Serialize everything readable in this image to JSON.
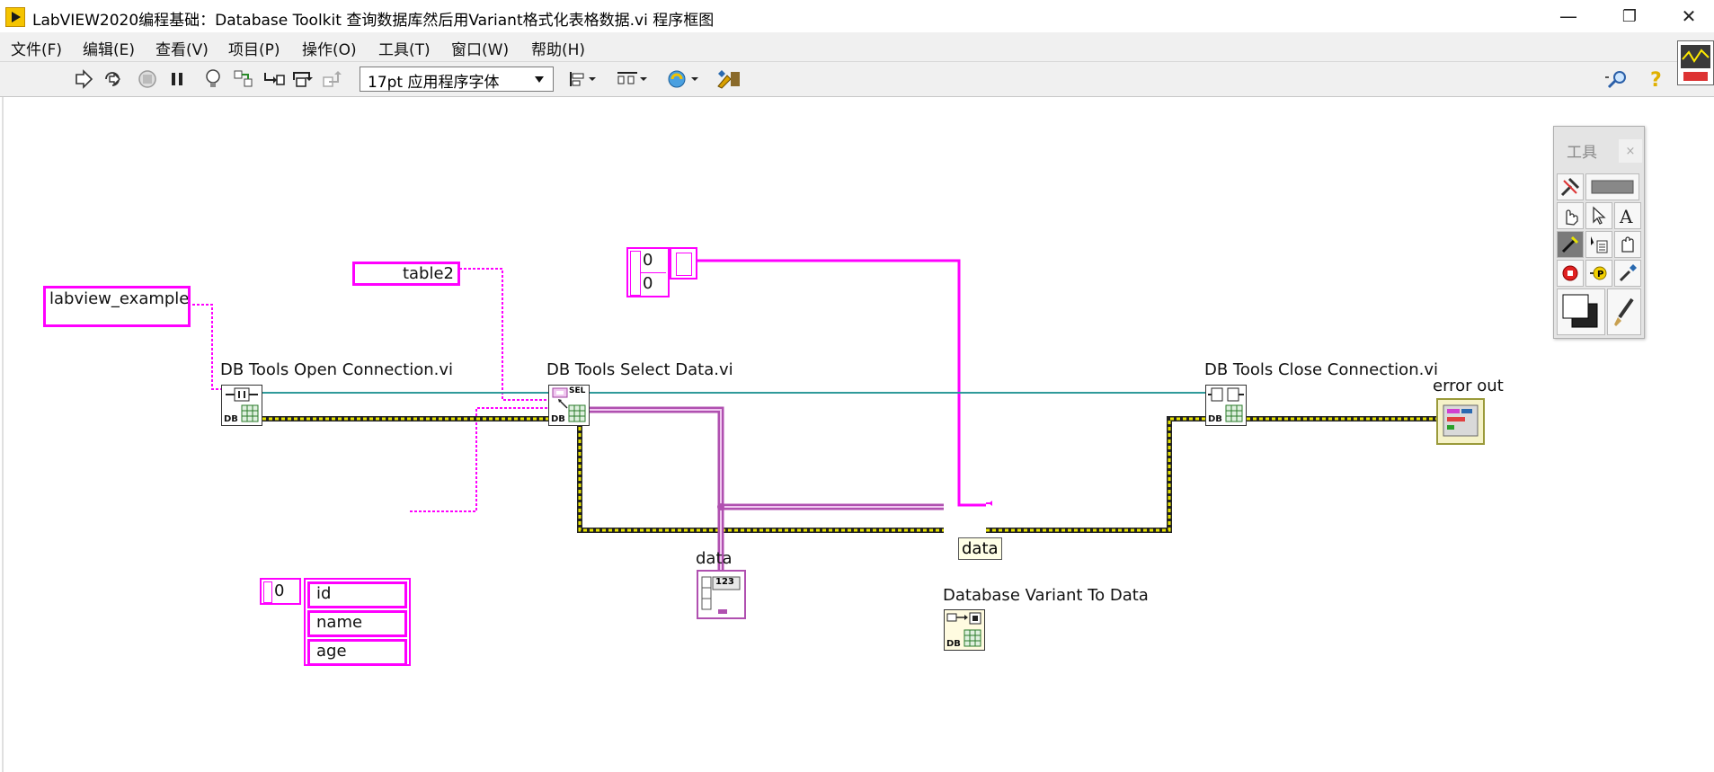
{
  "window": {
    "title": "LabVIEW2020编程基础：Database Toolkit 查询数据库然后用Variant格式化表格数据.vi 程序框图",
    "minimize": "—",
    "restore": "❐",
    "close": "✕"
  },
  "menu": [
    {
      "label": "文件(F)"
    },
    {
      "label": "编辑(E)"
    },
    {
      "label": "查看(V)"
    },
    {
      "label": "项目(P)"
    },
    {
      "label": "操作(O)"
    },
    {
      "label": "工具(T)"
    },
    {
      "label": "窗口(W)"
    },
    {
      "label": "帮助(H)"
    }
  ],
  "toolbar": {
    "font_value": "17pt 应用程序字体",
    "icons": [
      "run-arrow-icon",
      "run-continuously-icon",
      "abort-icon",
      "pause-icon",
      "highlight-execution-icon",
      "retain-wire-values-icon",
      "step-into-icon",
      "step-over-icon",
      "step-out-icon",
      "align-objects-icon",
      "distribute-objects-icon",
      "reorder-icon",
      "cleanup-diagram-icon",
      "search-icon",
      "context-help-icon"
    ]
  },
  "diagram": {
    "constants": {
      "db_name": "labview_example",
      "table_name": "table2",
      "array_index_a": "0",
      "array_index_b": "0",
      "columns_index": "0",
      "columns": [
        "id",
        "name",
        "age"
      ]
    },
    "nodes": {
      "open_connection": "DB Tools Open Connection.vi",
      "select_data": "DB Tools Select Data.vi",
      "variant_to_data": "Database Variant To Data",
      "close_connection": "DB Tools Close Connection.vi",
      "error_out": "error out",
      "data_indicator": "data",
      "data_tip": "data",
      "db_tag": "DB",
      "sel_tag": "SEL",
      "num_tag": "123"
    },
    "colors": {
      "string_wire": "#ff00ff",
      "refnum_wire": "#008080",
      "error_wire": "#b5b400",
      "variant_wire": "#b040b0"
    }
  },
  "tools_palette": {
    "title": "工具",
    "close": "×"
  }
}
